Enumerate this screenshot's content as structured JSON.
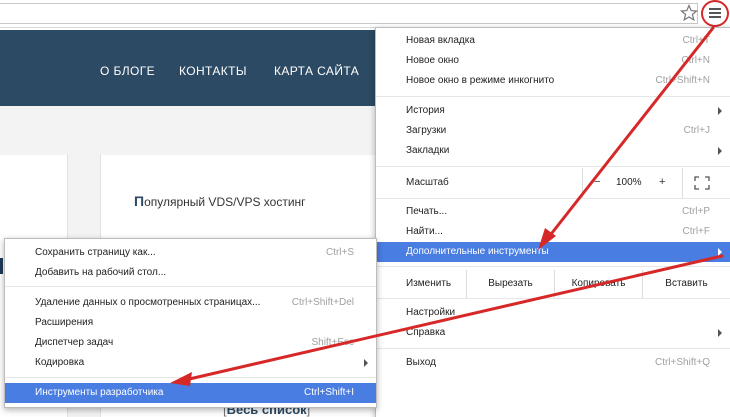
{
  "site": {
    "nav": [
      "О БЛОГЕ",
      "КОНТАКТЫ",
      "КАРТА САЙТА"
    ],
    "popular_first": "П",
    "popular_rest": "опулярный VDS/VPS хостинг",
    "whole_list": "Весь список"
  },
  "main_menu": {
    "items": [
      {
        "label": "Новая вкладка",
        "shortcut": "Ctrl+T"
      },
      {
        "label": "Новое окно",
        "shortcut": "Ctrl+N"
      },
      {
        "label": "Новое окно в режиме инкогнито",
        "shortcut": "Ctrl+Shift+N"
      },
      {
        "label": "История",
        "shortcut": ""
      },
      {
        "label": "Загрузки",
        "shortcut": "Ctrl+J"
      },
      {
        "label": "Закладки",
        "shortcut": ""
      },
      {
        "label": "Печать...",
        "shortcut": "Ctrl+P"
      },
      {
        "label": "Найти...",
        "shortcut": "Ctrl+F"
      },
      {
        "label": "Дополнительные инструменты",
        "shortcut": ""
      },
      {
        "label": "Настройки",
        "shortcut": ""
      },
      {
        "label": "Справка",
        "shortcut": ""
      },
      {
        "label": "Выход",
        "shortcut": "Ctrl+Shift+Q"
      }
    ],
    "zoom": {
      "label": "Масштаб",
      "minus": "−",
      "value": "100%",
      "plus": "+"
    },
    "edit": {
      "label": "Изменить",
      "cut": "Вырезать",
      "copy": "Копировать",
      "paste": "Вставить"
    }
  },
  "sub_menu": {
    "items": [
      {
        "label": "Сохранить страницу как...",
        "shortcut": "Ctrl+S"
      },
      {
        "label": "Добавить на рабочий стол...",
        "shortcut": ""
      },
      {
        "label": "Удаление данных о просмотренных страницах...",
        "shortcut": "Ctrl+Shift+Del"
      },
      {
        "label": "Расширения",
        "shortcut": ""
      },
      {
        "label": "Диспетчер задач",
        "shortcut": "Shift+Esc"
      },
      {
        "label": "Кодировка",
        "shortcut": ""
      },
      {
        "label": "Инструменты разработчика",
        "shortcut": "Ctrl+Shift+I"
      }
    ]
  },
  "colors": {
    "highlight": "#4a7de2",
    "site_header": "#2c4a63",
    "annotation": "#d72828"
  },
  "icons": [
    "star-icon",
    "hamburger-menu-icon",
    "fullscreen-icon",
    "chevron-right-icon"
  ]
}
